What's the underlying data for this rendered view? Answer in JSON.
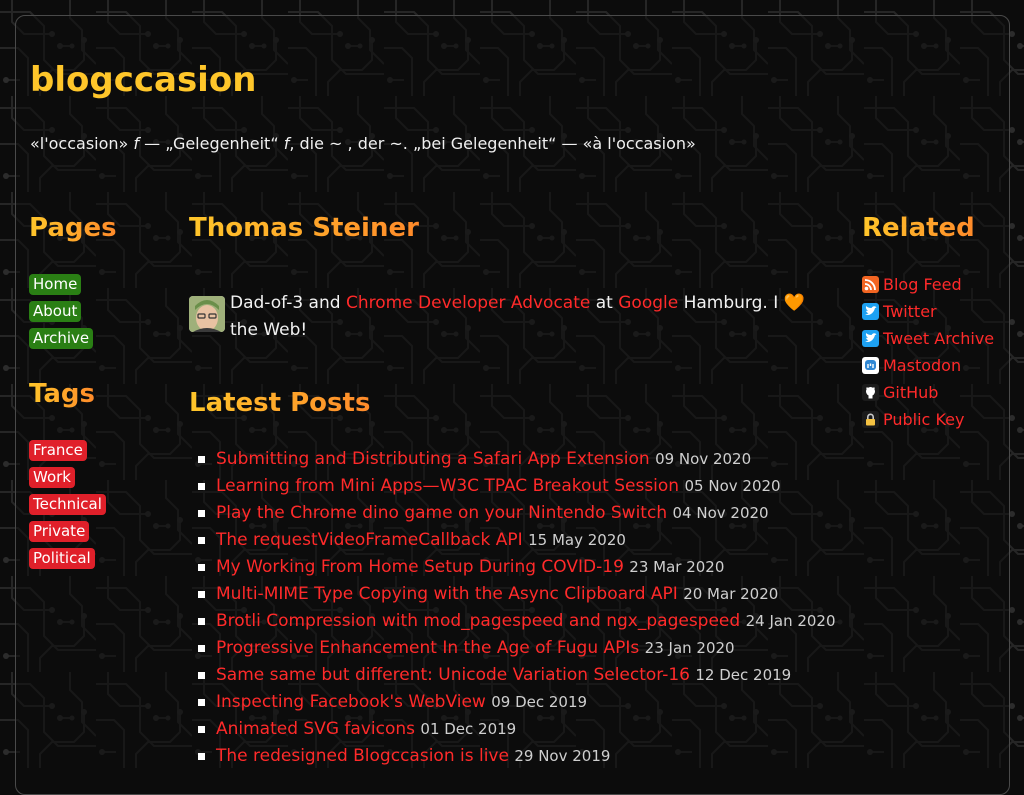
{
  "site": {
    "title": "blogccasion",
    "tagline_pre": "«l'occasion» ",
    "tagline_f1": "f",
    "tagline_mid": " — „Gelegenheit“ ",
    "tagline_f2": "f",
    "tagline_post": ", die ~ , der ~. „bei Gelegenheit“ — «à l'occasion»"
  },
  "pages": {
    "heading": "Pages",
    "items": [
      "Home",
      "About",
      "Archive"
    ]
  },
  "tags": {
    "heading": "Tags",
    "items": [
      "France",
      "Work",
      "Technical",
      "Private",
      "Political"
    ]
  },
  "author": {
    "name": "Thomas Steiner",
    "bio_1": "Dad-of-3 and ",
    "bio_link_1": "Chrome Developer Advocate",
    "bio_2": " at ",
    "bio_link_2": "Google",
    "bio_3": " Hamburg. I ",
    "heart": "🧡",
    "bio_4": " the Web!"
  },
  "latest": {
    "heading": "Latest Posts",
    "posts": [
      {
        "title": "Submitting and Distributing a Safari App Extension",
        "date": "09 Nov 2020"
      },
      {
        "title": "Learning from Mini Apps—W3C TPAC Breakout Session",
        "date": "05 Nov 2020"
      },
      {
        "title": "Play the Chrome dino game on your Nintendo Switch",
        "date": "04 Nov 2020"
      },
      {
        "title": "The requestVideoFrameCallback API",
        "date": "15 May 2020"
      },
      {
        "title": "My Working From Home Setup During COVID-19",
        "date": "23 Mar 2020"
      },
      {
        "title": "Multi-MIME Type Copying with the Async Clipboard API",
        "date": "20 Mar 2020"
      },
      {
        "title": "Brotli Compression with mod_pagespeed and ngx_pagespeed",
        "date": "24 Jan 2020"
      },
      {
        "title": "Progressive Enhancement In the Age of Fugu APIs",
        "date": "23 Jan 2020"
      },
      {
        "title": "Same same but different: Unicode Variation Selector-16",
        "date": "12 Dec 2019"
      },
      {
        "title": "Inspecting Facebook's WebView",
        "date": "09 Dec 2019"
      },
      {
        "title": "Animated SVG favicons",
        "date": "01 Dec 2019"
      },
      {
        "title": "The redesigned Blogccasion is live",
        "date": "29 Nov 2019"
      }
    ]
  },
  "related": {
    "heading": "Related",
    "items": [
      {
        "label": "Blog Feed",
        "icon": "rss-icon",
        "color": "#f26522"
      },
      {
        "label": "Twitter",
        "icon": "twitter-icon",
        "color": "#1da1f2"
      },
      {
        "label": "Tweet Archive",
        "icon": "twitter-icon",
        "color": "#1da1f2"
      },
      {
        "label": "Mastodon",
        "icon": "mastodon-icon",
        "color": "#ffffff"
      },
      {
        "label": "GitHub",
        "icon": "github-icon",
        "color": "#1b1b1b"
      },
      {
        "label": "Public Key",
        "icon": "lock-icon",
        "color": "#1b1b1b"
      }
    ]
  },
  "colors": {
    "title": "#ffc62a",
    "heading_start": "#ffc62a",
    "heading_end": "#ff8a2a",
    "link": "#ff2a2a",
    "pill_green": "#2a7f14",
    "pill_red": "#e0202a"
  }
}
